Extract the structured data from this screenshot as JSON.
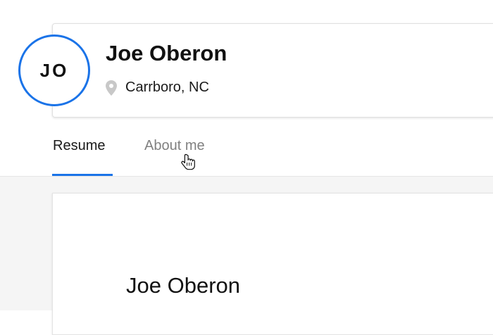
{
  "profile": {
    "initials": "JO",
    "name": "Joe Oberon",
    "location": "Carrboro, NC",
    "location_icon": "map-pin-icon"
  },
  "tabs": [
    {
      "label": "Resume",
      "active": true
    },
    {
      "label": "About me",
      "active": false
    }
  ],
  "resume": {
    "name": "Joe Oberon"
  },
  "colors": {
    "accent": "#1a73e8",
    "inactive_tab": "#808080",
    "page_background": "#f5f5f5"
  },
  "cursor_icon": "hand-pointer-icon"
}
